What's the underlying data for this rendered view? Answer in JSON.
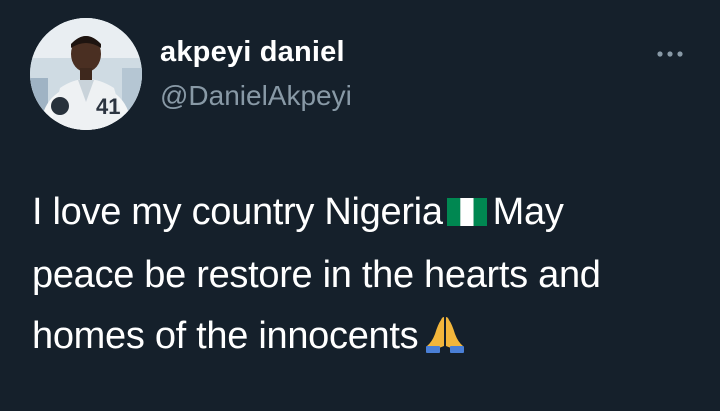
{
  "tweet": {
    "author": {
      "display_name": "akpeyi daniel",
      "handle": "@DanielAkpeyi",
      "avatar_icon": "user-avatar-photo"
    },
    "more_icon": "more-horizontal-icon",
    "body": {
      "segment_1": "I love my country Nigeria",
      "emoji_1": "nigeria-flag-icon",
      "segment_2": "May",
      "line_2": "peace be restore in the hearts and",
      "line_3": "homes of the innocents",
      "emoji_2": "folded-hands-icon"
    },
    "colors": {
      "background": "#15202b",
      "primary_text": "#ffffff",
      "secondary_text": "#8899a6",
      "flag_green": "#008751"
    }
  }
}
